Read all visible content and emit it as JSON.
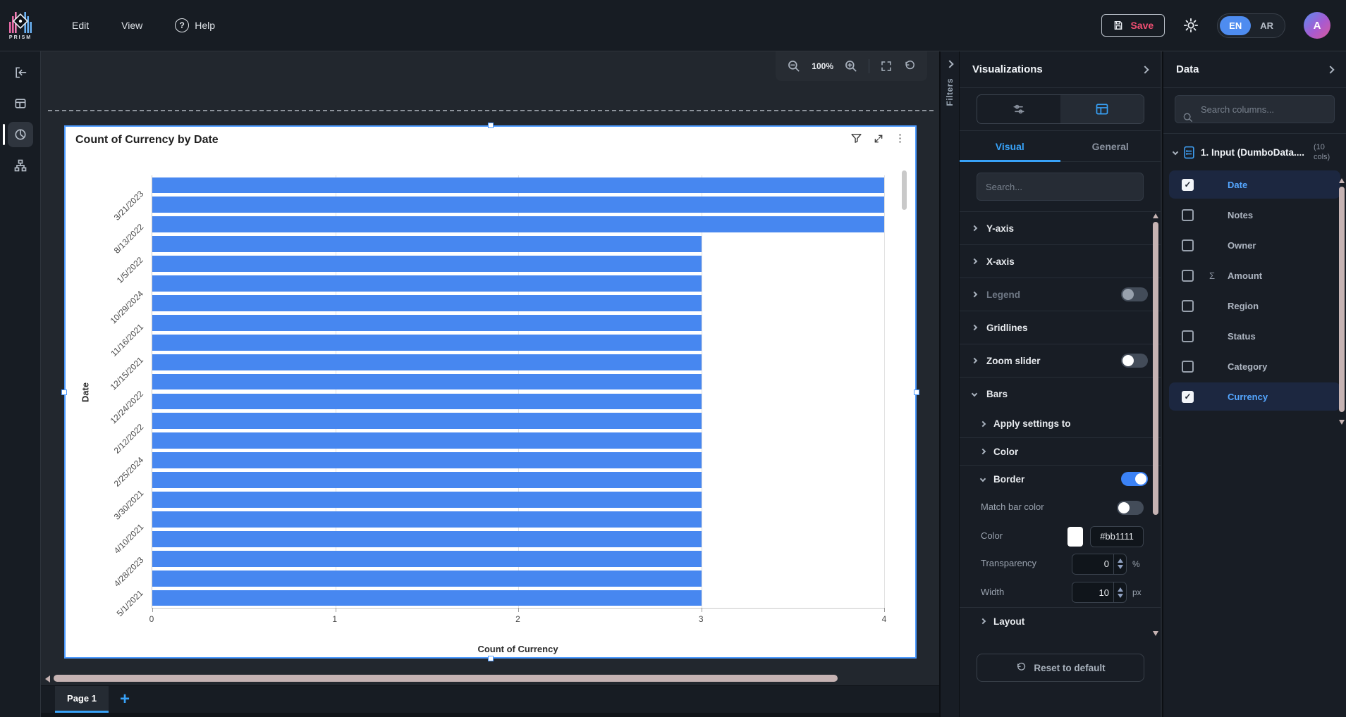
{
  "topbar": {
    "brand": "PRISM",
    "menu_edit": "Edit",
    "menu_view": "View",
    "menu_help": "Help",
    "save_label": "Save",
    "lang_en": "EN",
    "lang_ar": "AR",
    "avatar_letter": "A"
  },
  "canvas": {
    "zoom_level": "100%",
    "filters_label": "Filters",
    "page_tab_label": "Page 1"
  },
  "icons": {
    "kebab": "⋮",
    "sigma": "Σ",
    "check": "✓",
    "plus": "+",
    "question": "?"
  },
  "chart_data": {
    "type": "bar",
    "orientation": "horizontal",
    "title": "Count of Currency by Date",
    "xlabel": "Count of Currency",
    "ylabel": "Date",
    "categories": [
      "3/21/2023",
      "8/13/2022",
      "1/5/2022",
      "10/29/2024",
      "11/16/2021",
      "12/15/2021",
      "12/24/2022",
      "2/12/2022",
      "2/25/2024",
      "3/30/2021",
      "4/10/2021",
      "4/28/2023",
      "5/1/2021"
    ],
    "values": [
      4,
      4,
      4,
      3,
      3,
      3,
      3,
      3,
      3,
      3,
      3,
      3,
      3,
      3,
      3,
      3,
      3,
      3,
      3,
      3,
      3,
      3
    ],
    "xlim": [
      0,
      4
    ],
    "xticks": [
      0,
      1,
      2,
      3,
      4
    ],
    "bar_color": "#4787f0",
    "grid": true,
    "legend": false
  },
  "viz": {
    "title": "Visualizations",
    "tab_visual": "Visual",
    "tab_general": "General",
    "search_placeholder": "Search...",
    "sections": [
      {
        "label": "Y-axis"
      },
      {
        "label": "X-axis"
      },
      {
        "label": "Legend",
        "toggle": "off"
      },
      {
        "label": "Gridlines"
      },
      {
        "label": "Zoom slider",
        "toggle": "off"
      },
      {
        "label": "Bars",
        "expanded": true
      }
    ],
    "bars": {
      "apply_label": "Apply settings to",
      "color_label": "Color",
      "border_label": "Border",
      "border_enabled": true,
      "match_label": "Match bar color",
      "border_color_label": "Color",
      "border_color_value": "#bb1111",
      "transparency_label": "Transparency",
      "transparency_value": "0",
      "transparency_unit": "%",
      "width_label": "Width",
      "width_value": "10",
      "width_unit": "px",
      "layout_label": "Layout"
    },
    "reset_label": "Reset to default"
  },
  "data_panel": {
    "title": "Data",
    "search_placeholder": "Search columns...",
    "source_name": "1. Input (DumboData....",
    "source_cols": "(10 cols)",
    "columns": [
      {
        "label": "Date",
        "checked": true,
        "selected": true
      },
      {
        "label": "Notes",
        "checked": false
      },
      {
        "label": "Owner",
        "checked": false
      },
      {
        "label": "Amount",
        "checked": false,
        "sigma": true
      },
      {
        "label": "Region",
        "checked": false
      },
      {
        "label": "Status",
        "checked": false
      },
      {
        "label": "Category",
        "checked": false
      },
      {
        "label": "Currency",
        "checked": true,
        "selected": true
      }
    ]
  }
}
